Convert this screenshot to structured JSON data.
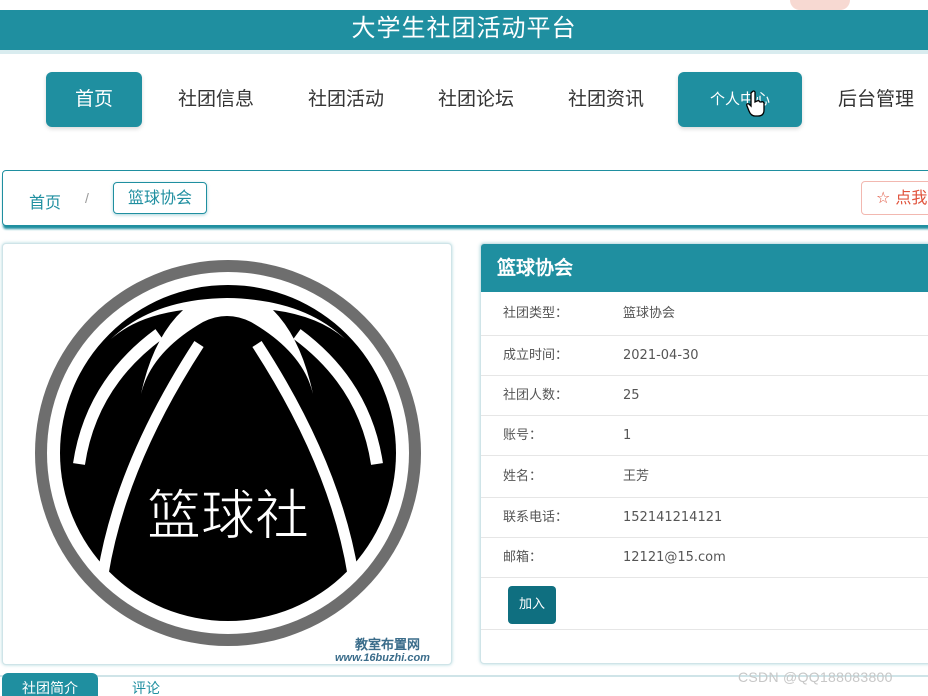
{
  "app": {
    "title": "大学生社团活动平台"
  },
  "nav": {
    "items": [
      {
        "label": "首页",
        "state": "active"
      },
      {
        "label": "社团信息",
        "state": "normal"
      },
      {
        "label": "社团活动",
        "state": "normal"
      },
      {
        "label": "社团论坛",
        "state": "normal"
      },
      {
        "label": "社团资讯",
        "state": "normal"
      },
      {
        "label": "个人中心",
        "state": "hover"
      },
      {
        "label": "后台管理",
        "state": "normal"
      }
    ]
  },
  "breadcrumb": {
    "home": "首页",
    "separator": "/",
    "current": "篮球协会"
  },
  "favorite": {
    "icon": "star-outline-icon",
    "label": "☆ 点我收藏"
  },
  "club_image": {
    "text": "篮球社",
    "watermark_line1": "教室布置网",
    "watermark_line2": "www.16buzhi.com"
  },
  "info": {
    "title": "篮球协会",
    "rows": [
      {
        "label": "社团类型：",
        "value": "篮球协会"
      },
      {
        "label": "成立时间：",
        "value": "2021-04-30"
      },
      {
        "label": "社团人数：",
        "value": "25"
      },
      {
        "label": "账号：",
        "value": "1"
      },
      {
        "label": "姓名：",
        "value": "王芳"
      },
      {
        "label": "联系电话：",
        "value": "152141214121"
      },
      {
        "label": "邮箱：",
        "value": "12121@15.com"
      }
    ],
    "join_label": "加入"
  },
  "tabs": [
    {
      "label": "社团简介",
      "state": "active"
    },
    {
      "label": "评论",
      "state": "normal"
    }
  ],
  "watermark": "CSDN @QQ188083800",
  "colors": {
    "primary": "#1f8fa0",
    "button_dark": "#0f6f80",
    "favorite": "#e0533c"
  }
}
